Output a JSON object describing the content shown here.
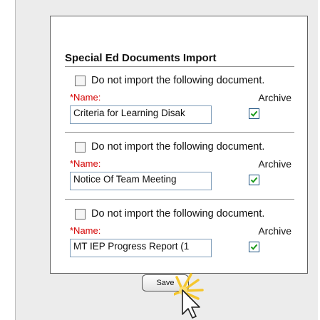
{
  "section": {
    "title": "Special Ed Documents Import"
  },
  "documents": [
    {
      "skip_label": "Do not import the following document.",
      "name_label": "*Name:",
      "archive_label": "Archive",
      "name_value": "Criteria for Learning Disak",
      "skip_checked": false,
      "archive_checked": true
    },
    {
      "skip_label": "Do not import the following document.",
      "name_label": "*Name:",
      "archive_label": "Archive",
      "name_value": "Notice Of Team Meeting",
      "skip_checked": false,
      "archive_checked": true
    },
    {
      "skip_label": "Do not import the following document.",
      "name_label": "*Name:",
      "archive_label": "Archive",
      "name_value": "MT IEP Progress Report (1",
      "skip_checked": false,
      "archive_checked": true
    }
  ],
  "actions": {
    "save_label": "Save"
  },
  "colors": {
    "required_label": "#d40000",
    "check_mark": "#1b9a1b",
    "highlight": "#f6c21a"
  },
  "icons": {
    "checkmark": "checkmark-icon",
    "cursor": "mouse-pointer-icon",
    "highlight": "click-highlight-icon"
  }
}
